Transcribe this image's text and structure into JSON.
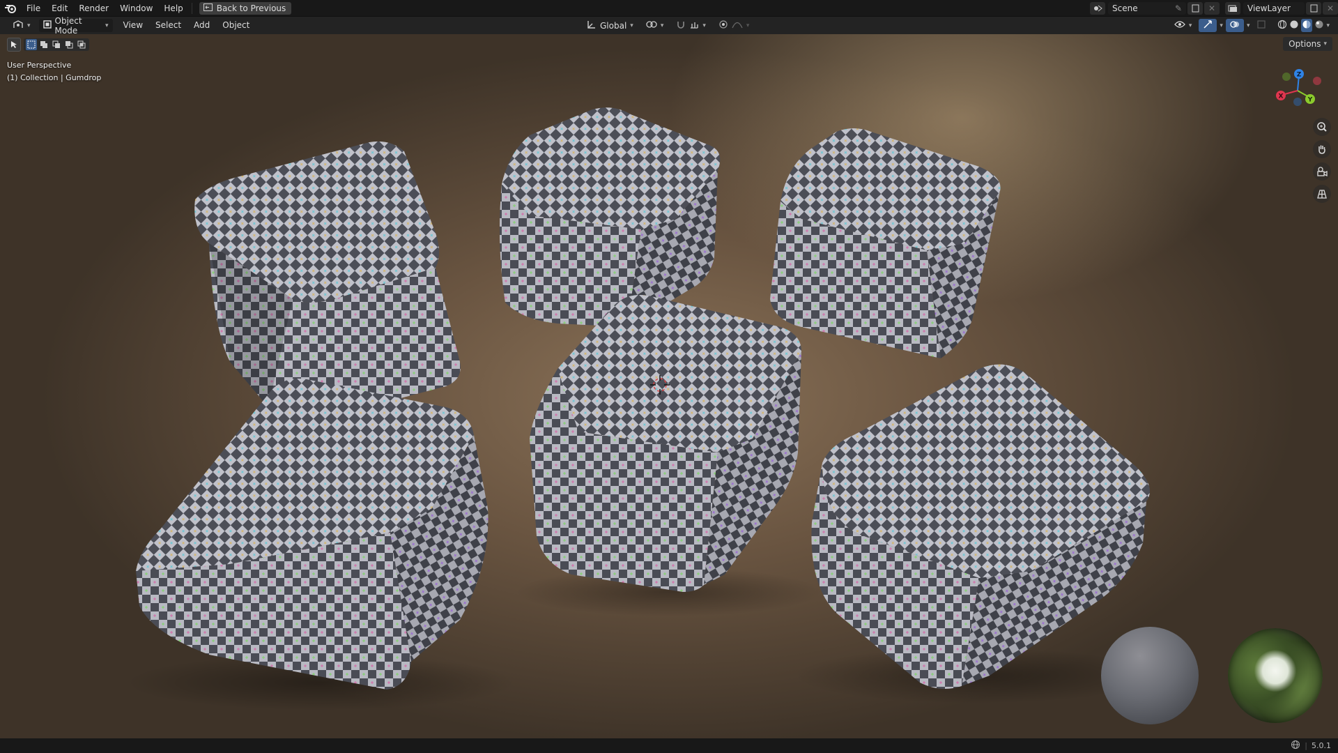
{
  "menubar": {
    "items": [
      "File",
      "Edit",
      "Render",
      "Window",
      "Help"
    ],
    "back_button": "Back to Previous",
    "scene_label": "Scene",
    "viewlayer_label": "ViewLayer"
  },
  "header": {
    "mode_label": "Object Mode",
    "menus": [
      "View",
      "Select",
      "Add",
      "Object"
    ],
    "transform_orientation": "Global"
  },
  "viewport": {
    "perspective_label": "User Perspective",
    "collection_label": "(1) Collection | Gumdrop",
    "options_label": "Options",
    "gizmo_axes": {
      "x": "X",
      "y": "Y",
      "z": "Z"
    },
    "colors": {
      "x_axis": "#e0364f",
      "y_axis": "#8bcb2c",
      "z_axis": "#2f83e6"
    }
  },
  "statusbar": {
    "version": "5.0.1"
  },
  "icons": [
    "blender-logo-icon",
    "back-icon",
    "editor-type-icon",
    "mode-icon",
    "orientation-icon",
    "pivot-icon",
    "snap-icon",
    "proportional-icon",
    "visibility-icon",
    "gizmo-icon",
    "overlay-icon",
    "xray-icon",
    "wireframe-shading-icon",
    "solid-shading-icon",
    "material-shading-icon",
    "rendered-shading-icon",
    "zoom-icon",
    "hand-icon",
    "camera-icon",
    "grid-icon",
    "network-icon"
  ]
}
